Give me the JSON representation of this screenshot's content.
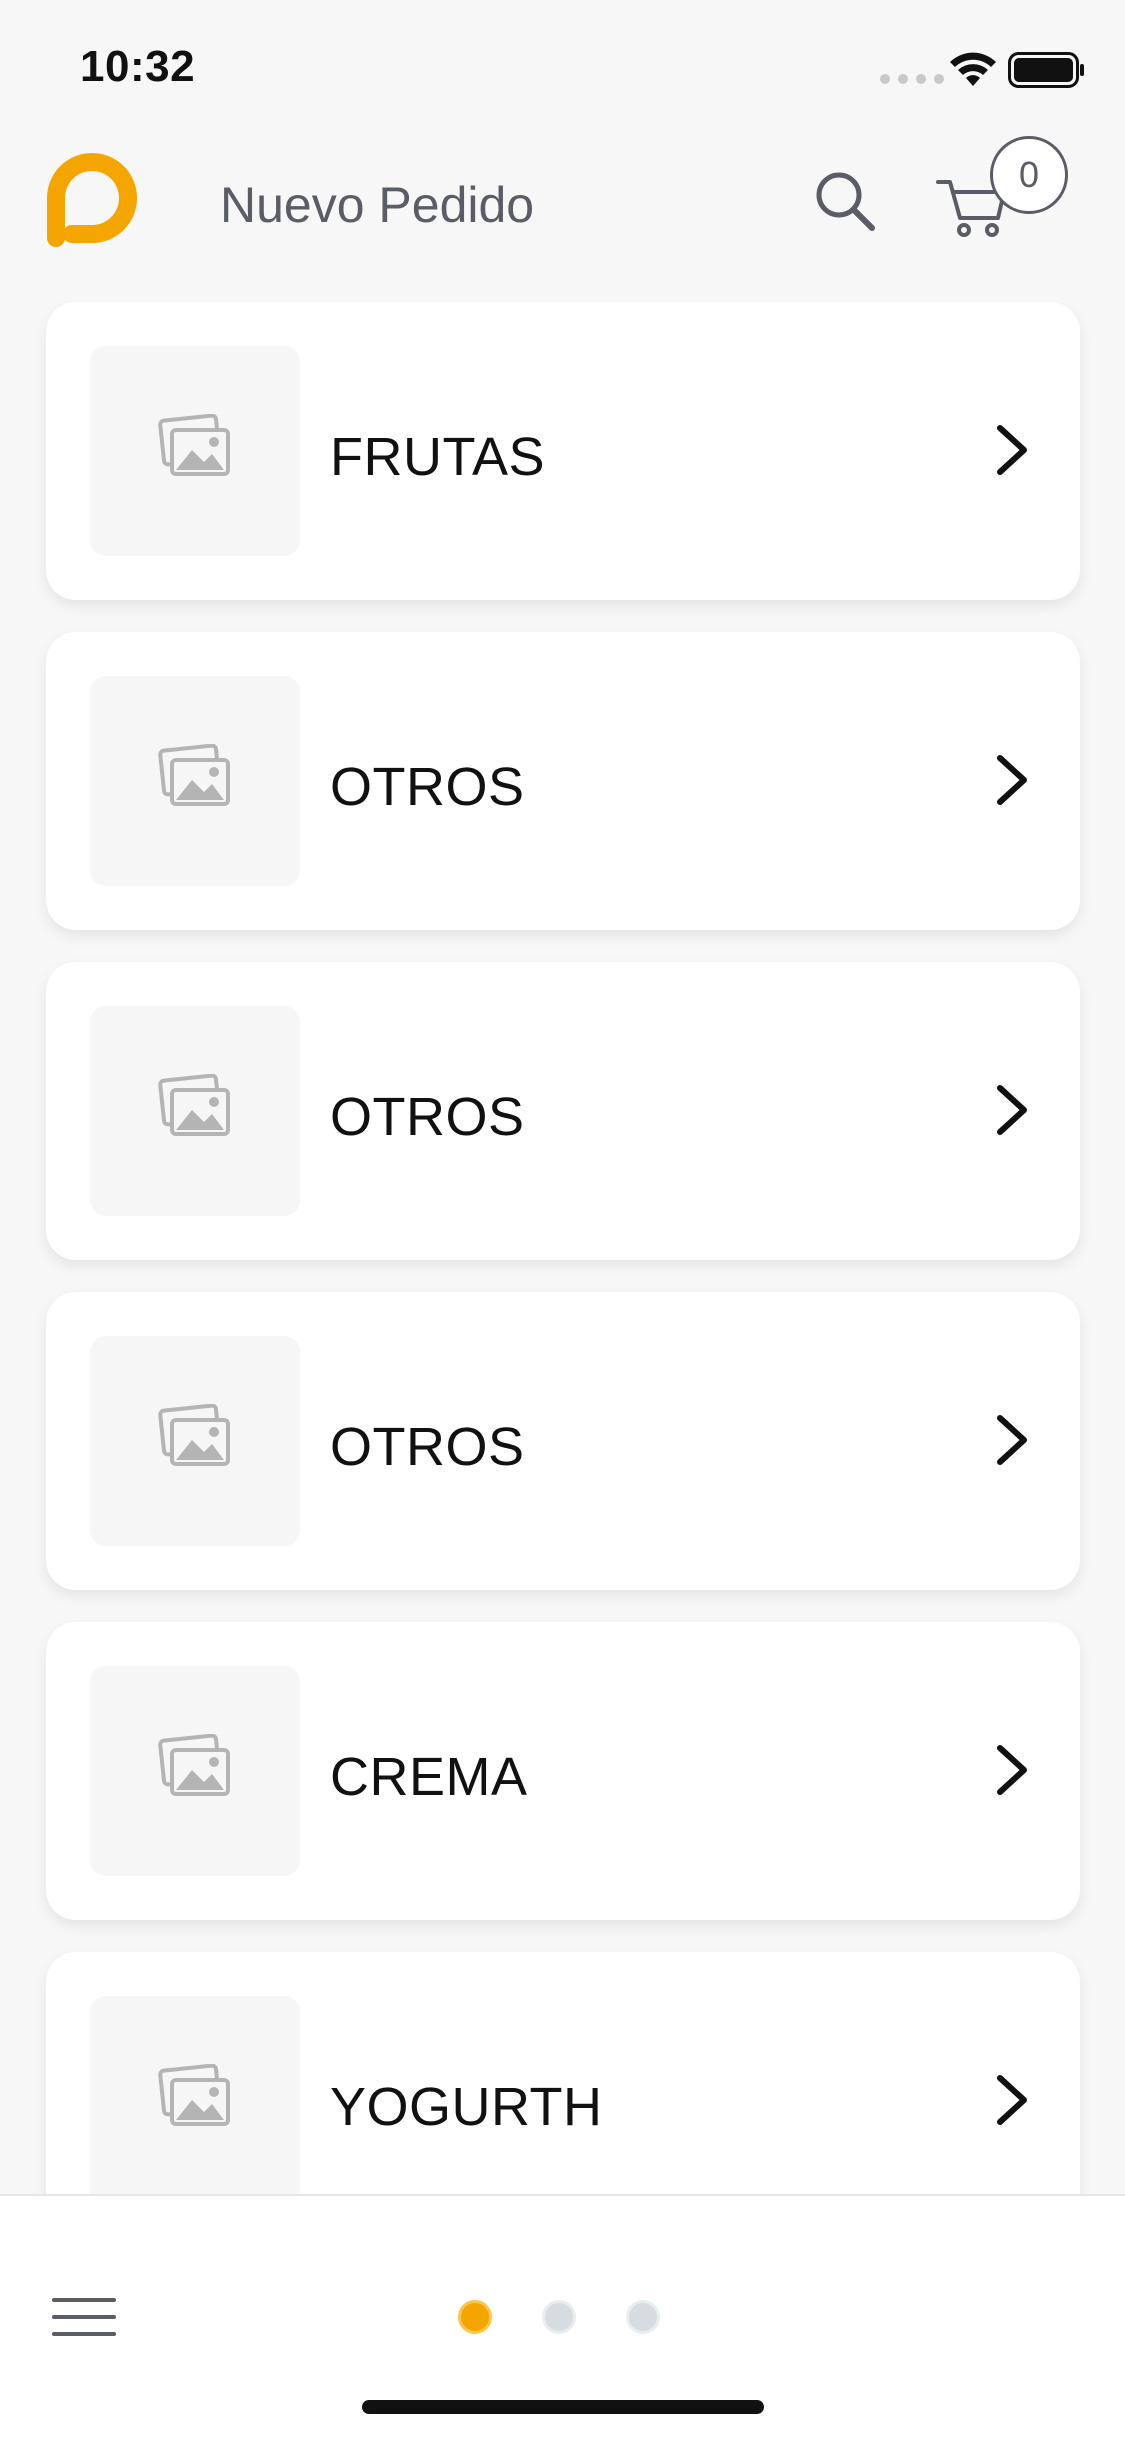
{
  "status_bar": {
    "time": "10:32"
  },
  "header": {
    "title": "Nuevo Pedido",
    "cart_count": "0",
    "logo_color": "#f5a500"
  },
  "categories": [
    {
      "label": "FRUTAS"
    },
    {
      "label": "OTROS"
    },
    {
      "label": "OTROS"
    },
    {
      "label": "OTROS"
    },
    {
      "label": "CREMA"
    },
    {
      "label": "YOGURTH"
    }
  ],
  "pager": {
    "total": 3,
    "active_index": 0,
    "active_color": "#f5a500",
    "inactive_color": "#d5dde0"
  },
  "icons": {
    "search": "search-icon",
    "cart": "cart-icon",
    "menu": "menu-icon",
    "chevron": "chevron-right-icon",
    "thumb": "image-placeholder-icon"
  }
}
